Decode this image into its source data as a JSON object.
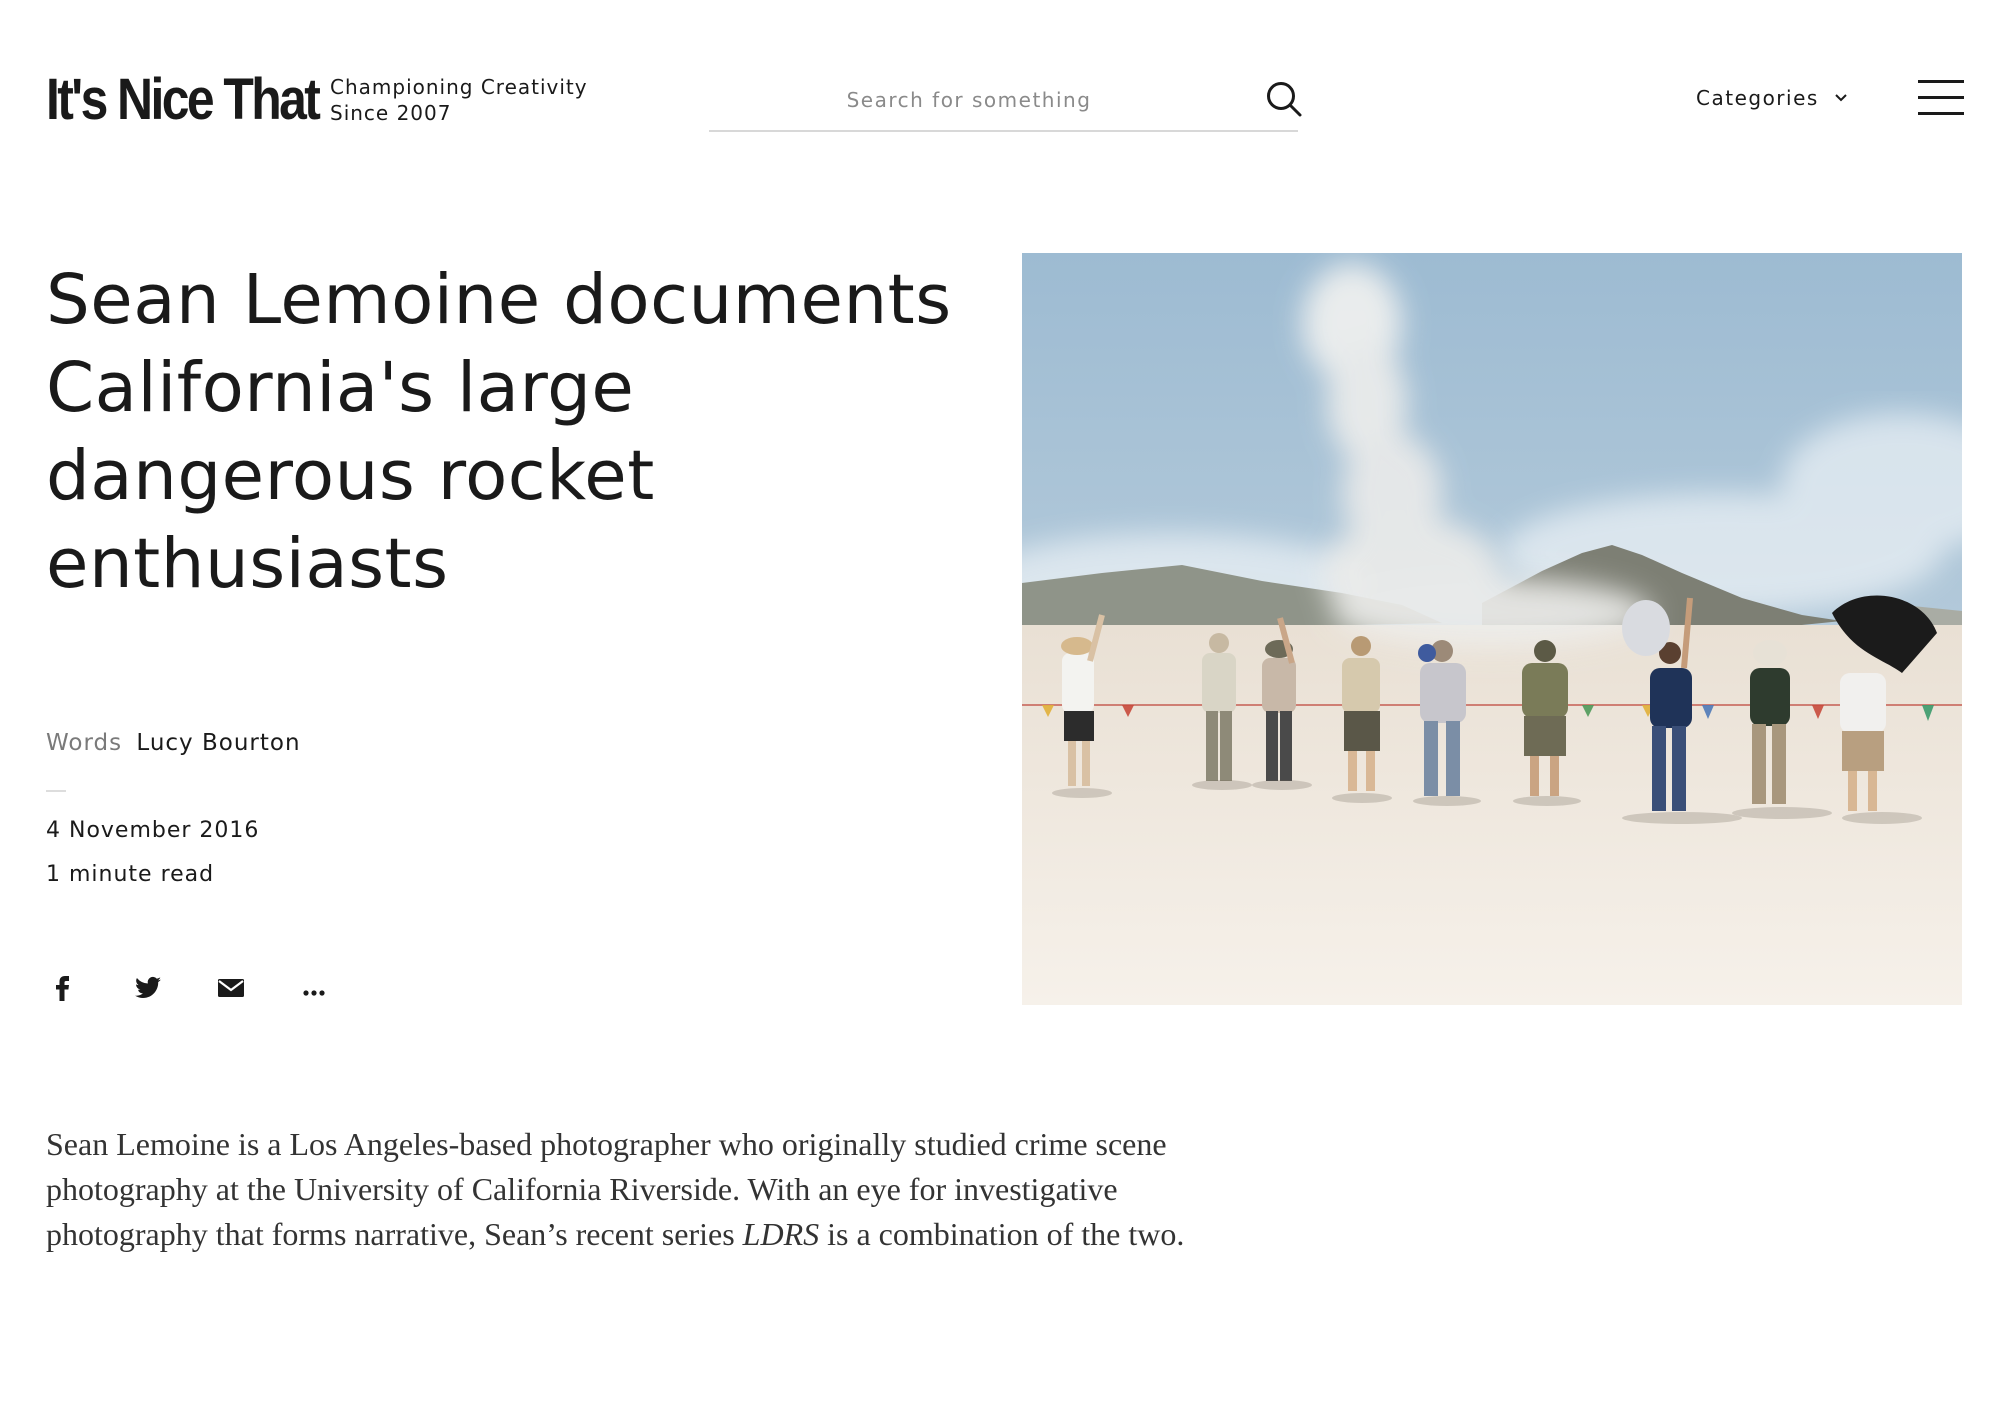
{
  "header": {
    "logo": "It's Nice That",
    "tagline_line1": "Championing Creativity",
    "tagline_line2": "Since 2007",
    "search_placeholder": "Search for something",
    "categories_label": "Categories"
  },
  "article": {
    "headline": "Sean Lemoine documents California's large dangerous rocket enthusiasts",
    "byline_label": "Words",
    "author": "Lucy Bourton",
    "date": "4 November 2016",
    "read_time": "1 minute read",
    "share_icons": [
      "facebook-icon",
      "twitter-icon",
      "email-icon",
      "more-icon"
    ],
    "body_before": "Sean Lemoine is a Los Angeles-based photographer who originally studied crime scene photography at the University of California Riverside. With an eye for investigative photography that forms narrative, Sean’s recent series ",
    "body_series": "LDRS",
    "body_after": " is a combination of the two."
  },
  "colors": {
    "text": "#1a1a1a",
    "muted": "#7a7a7a",
    "sky": "#a9c3d6",
    "ground": "#f1e9df"
  }
}
